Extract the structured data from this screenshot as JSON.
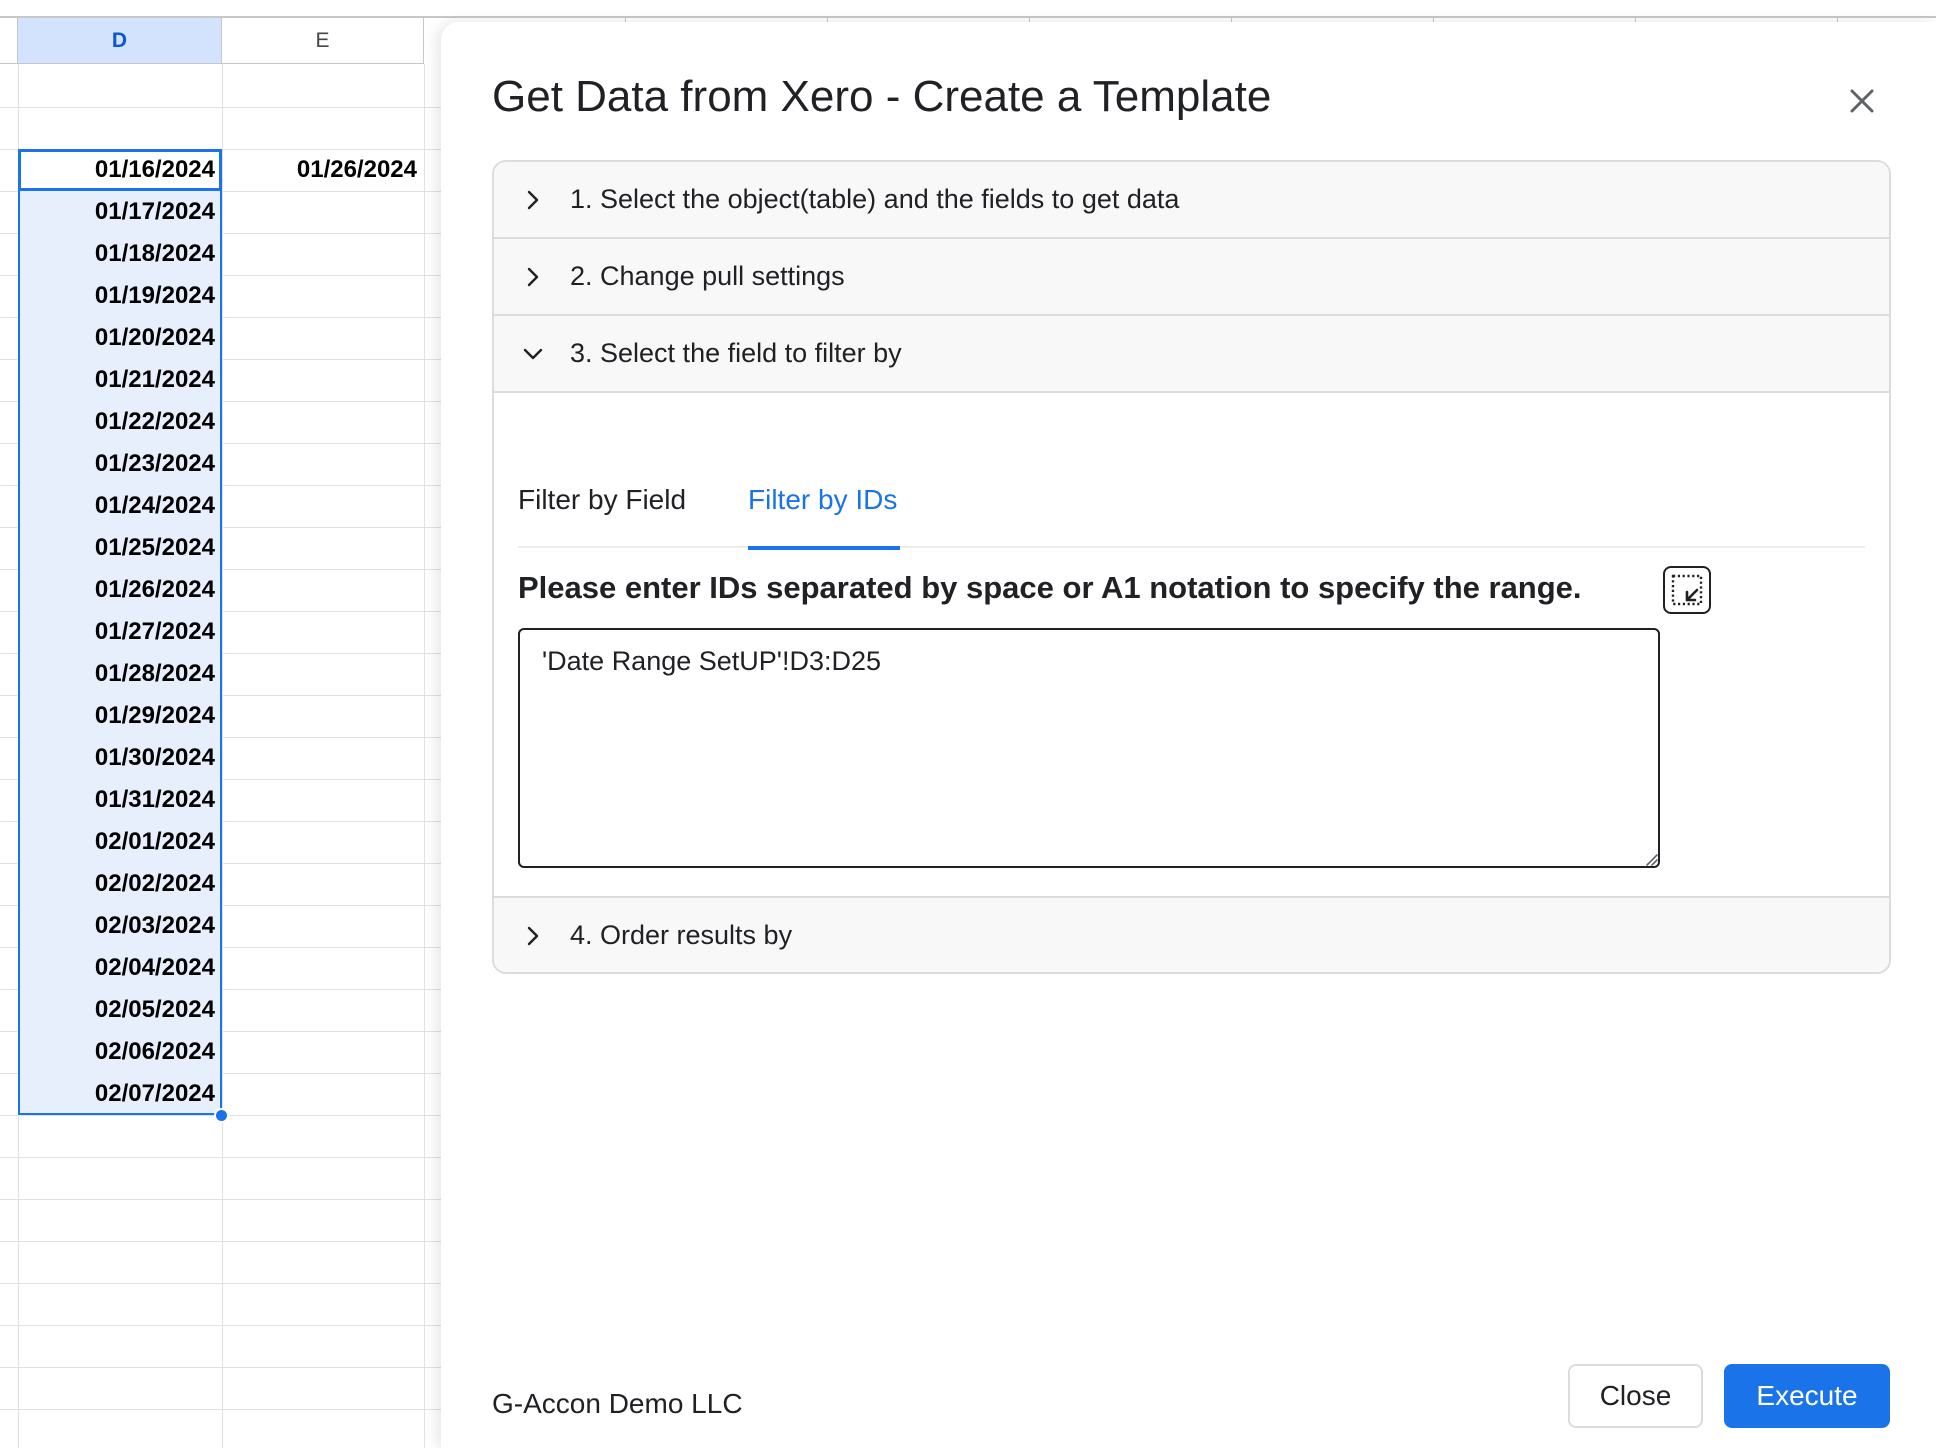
{
  "spreadsheet": {
    "column_headers": [
      "D",
      "E"
    ],
    "selected_column": "D",
    "column_d_values": [
      "01/16/2024",
      "01/17/2024",
      "01/18/2024",
      "01/19/2024",
      "01/20/2024",
      "01/21/2024",
      "01/22/2024",
      "01/23/2024",
      "01/24/2024",
      "01/25/2024",
      "01/26/2024",
      "01/27/2024",
      "01/28/2024",
      "01/29/2024",
      "01/30/2024",
      "01/31/2024",
      "02/01/2024",
      "02/02/2024",
      "02/03/2024",
      "02/04/2024",
      "02/05/2024",
      "02/06/2024",
      "02/07/2024"
    ],
    "column_e_first_value": "01/26/2024",
    "selection_color": "#1a73e8"
  },
  "dialog": {
    "title": "Get Data from Xero - Create a Template",
    "close_icon": "close-icon",
    "sections": [
      {
        "label": "1. Select the object(table) and the fields to get data",
        "expanded": false
      },
      {
        "label": "2. Change pull settings",
        "expanded": false
      },
      {
        "label": "3. Select the field to filter by",
        "expanded": true
      },
      {
        "label": "4. Order results by",
        "expanded": false
      }
    ],
    "tabs": [
      {
        "label": "Filter by Field",
        "active": false
      },
      {
        "label": "Filter by IDs",
        "active": true
      }
    ],
    "ids_prompt": "Please enter IDs separated by space or A1 notation to specify the range.",
    "ids_value": "'Date Range SetUP'!D3:D25",
    "range_picker_icon": "select-range-icon",
    "footer_org": "G-Accon Demo LLC",
    "close_button": "Close",
    "execute_button": "Execute",
    "accent_color": "#1a73e8"
  }
}
